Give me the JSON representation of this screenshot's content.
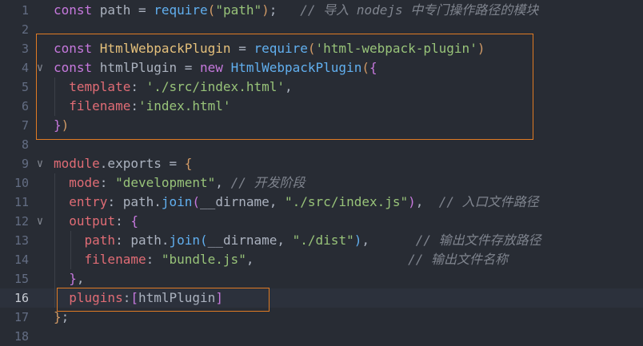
{
  "editor": {
    "lines": [
      {
        "n": "1",
        "code": [
          [
            "kw",
            "const "
          ],
          [
            "",
            "path "
          ],
          [
            "",
            "= "
          ],
          [
            "fn",
            "require"
          ],
          [
            "p1",
            "("
          ],
          [
            "str",
            "\"path\""
          ],
          [
            "p1",
            ")"
          ],
          [
            "",
            ";   "
          ],
          [
            "cm",
            "// 导入 nodejs 中专门操作路径的模块"
          ]
        ]
      },
      {
        "n": "2",
        "code": []
      },
      {
        "n": "3",
        "code": [
          [
            "kw",
            "const "
          ],
          [
            "cls",
            "HtmlWebpackPlugin "
          ],
          [
            "",
            "= "
          ],
          [
            "fn",
            "require"
          ],
          [
            "p1",
            "("
          ],
          [
            "str",
            "'html-webpack-plugin'"
          ],
          [
            "p1",
            ")"
          ]
        ]
      },
      {
        "n": "4",
        "fold": true,
        "code": [
          [
            "kw",
            "const "
          ],
          [
            "",
            "htmlPlugin "
          ],
          [
            "",
            "= "
          ],
          [
            "kw",
            "new "
          ],
          [
            "fn",
            "HtmlWebpackPlugin"
          ],
          [
            "p1",
            "("
          ],
          [
            "p2",
            "{"
          ]
        ]
      },
      {
        "n": "5",
        "code": [
          [
            "",
            "  "
          ],
          [
            "prop",
            "template"
          ],
          [
            "",
            ": "
          ],
          [
            "str",
            "'./src/index.html'"
          ],
          [
            "",
            ","
          ]
        ]
      },
      {
        "n": "6",
        "code": [
          [
            "",
            "  "
          ],
          [
            "prop",
            "filename"
          ],
          [
            "",
            ":"
          ],
          [
            "str",
            "'index.html'"
          ]
        ]
      },
      {
        "n": "7",
        "code": [
          [
            "p2",
            "}"
          ],
          [
            "p1",
            ")"
          ]
        ]
      },
      {
        "n": "8",
        "code": []
      },
      {
        "n": "9",
        "fold": true,
        "code": [
          [
            "prop",
            "module"
          ],
          [
            "",
            ".exports "
          ],
          [
            "",
            "= "
          ],
          [
            "p1",
            "{"
          ]
        ]
      },
      {
        "n": "10",
        "code": [
          [
            "",
            "  "
          ],
          [
            "prop",
            "mode"
          ],
          [
            "",
            ": "
          ],
          [
            "str",
            "\"development\""
          ],
          [
            "",
            ", "
          ],
          [
            "cm",
            "// 开发阶段"
          ]
        ]
      },
      {
        "n": "11",
        "code": [
          [
            "",
            "  "
          ],
          [
            "prop",
            "entry"
          ],
          [
            "",
            ": path."
          ],
          [
            "fn",
            "join"
          ],
          [
            "p2",
            "("
          ],
          [
            "",
            "__dirname, "
          ],
          [
            "str",
            "\"./src/index.js\""
          ],
          [
            "p2",
            ")"
          ],
          [
            "",
            ",  "
          ],
          [
            "cm",
            "// 入口文件路径"
          ]
        ]
      },
      {
        "n": "12",
        "fold": true,
        "code": [
          [
            "",
            "  "
          ],
          [
            "prop",
            "output"
          ],
          [
            "",
            ": "
          ],
          [
            "p2",
            "{"
          ]
        ]
      },
      {
        "n": "13",
        "code": [
          [
            "",
            "    "
          ],
          [
            "prop",
            "path"
          ],
          [
            "",
            ": path."
          ],
          [
            "fn",
            "join"
          ],
          [
            "fn",
            "("
          ],
          [
            "",
            "__dirname, "
          ],
          [
            "str",
            "\"./dist\""
          ],
          [
            "fn",
            ")"
          ],
          [
            "",
            ",      "
          ],
          [
            "cm",
            "// 输出文件存放路径"
          ]
        ]
      },
      {
        "n": "14",
        "code": [
          [
            "",
            "    "
          ],
          [
            "prop",
            "filename"
          ],
          [
            "",
            ": "
          ],
          [
            "str",
            "\"bundle.js\""
          ],
          [
            "",
            ",                    "
          ],
          [
            "cm",
            "// 输出文件名称"
          ]
        ]
      },
      {
        "n": "15",
        "code": [
          [
            "",
            "  "
          ],
          [
            "p2",
            "}"
          ],
          [
            "",
            ","
          ]
        ]
      },
      {
        "n": "16",
        "current": true,
        "code": [
          [
            "",
            "  "
          ],
          [
            "prop",
            "plugins"
          ],
          [
            "",
            ":"
          ],
          [
            "p2",
            "["
          ],
          [
            "",
            "htmlPlugin"
          ],
          [
            "p2",
            "]"
          ]
        ]
      },
      {
        "n": "17",
        "code": [
          [
            "p1",
            "}"
          ],
          [
            "",
            ";"
          ]
        ]
      },
      {
        "n": "18",
        "code": []
      }
    ]
  },
  "colors": {
    "highlight_box": "#e07b24",
    "background": "#282c34"
  }
}
